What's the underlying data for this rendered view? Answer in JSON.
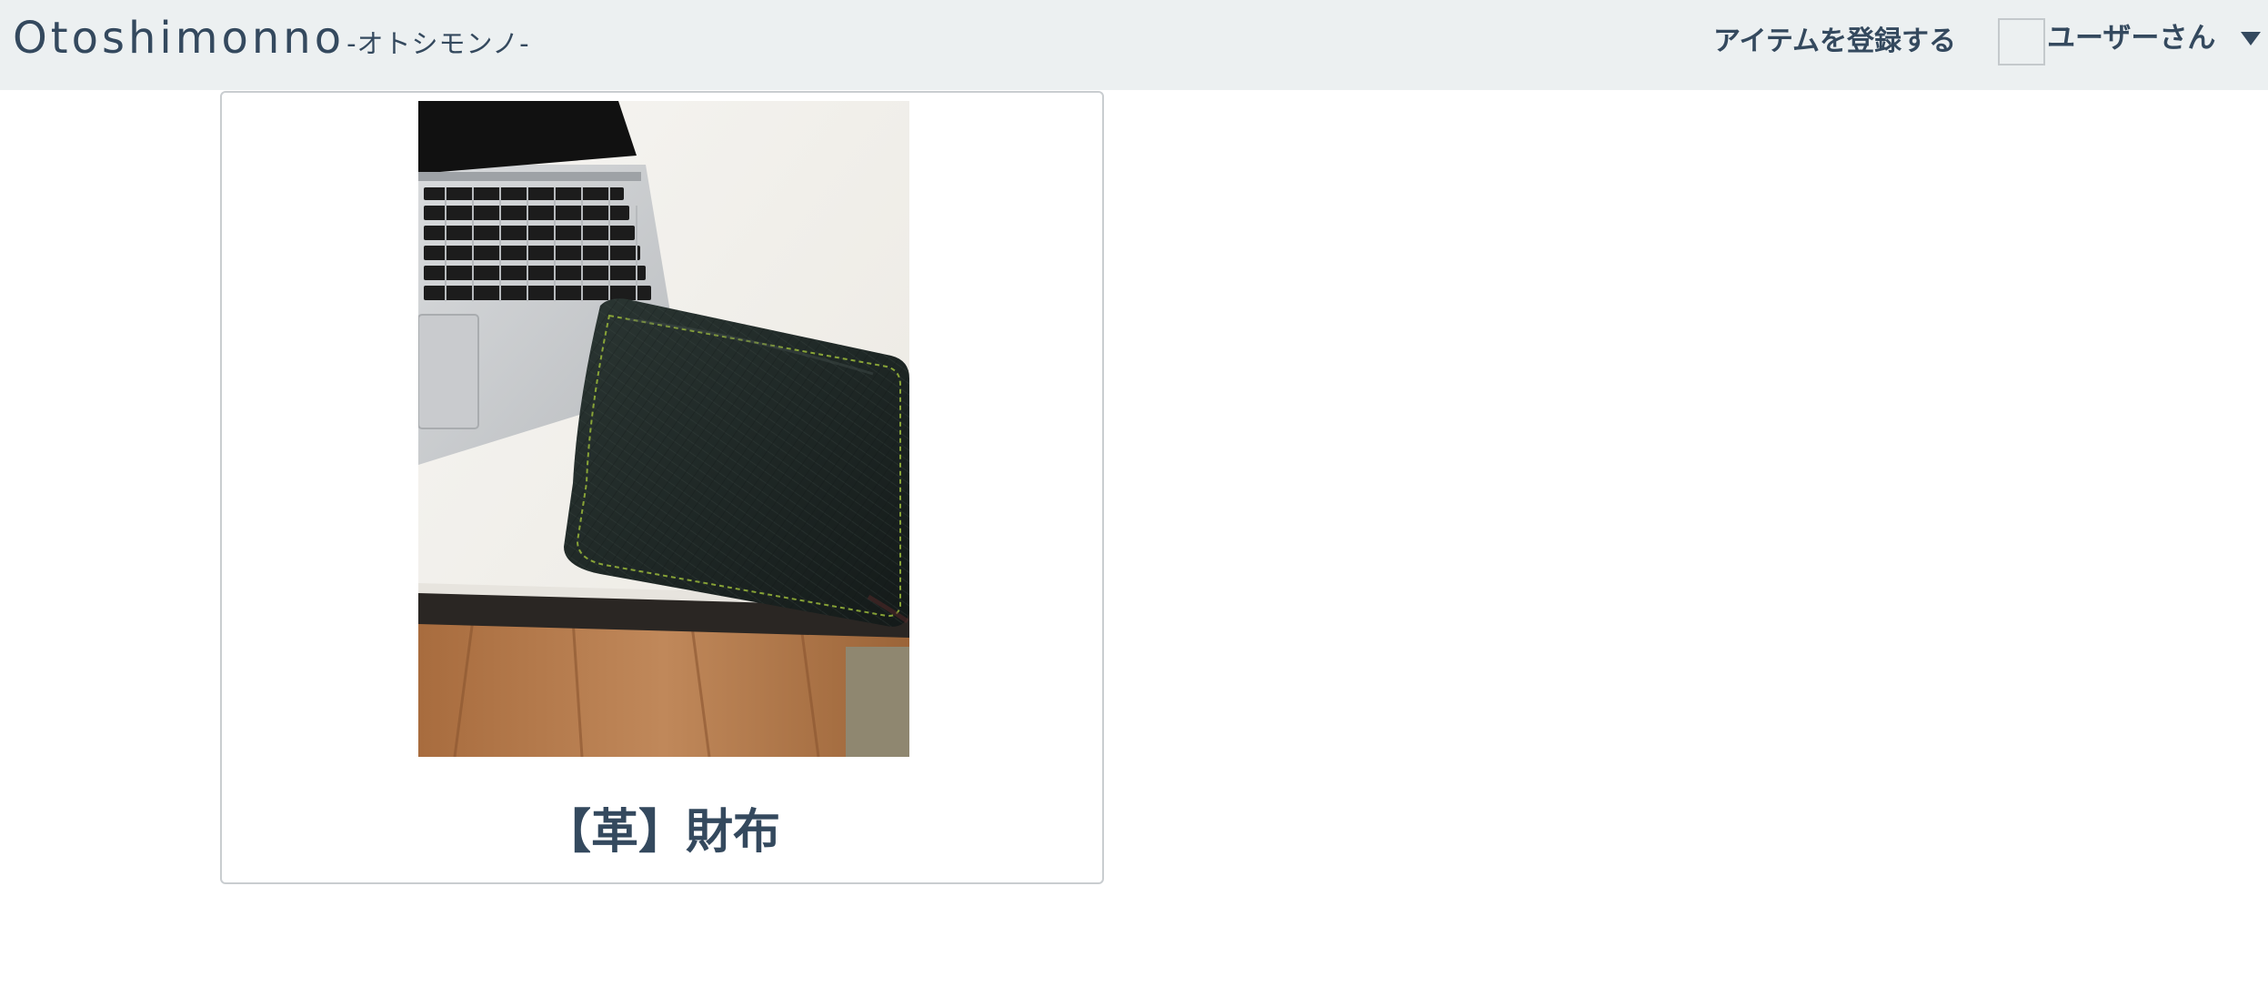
{
  "header": {
    "logo_main": "Otoshimonno",
    "logo_sub": "-オトシモンノ-",
    "register_link": "アイテムを登録する",
    "user_name": "ユーザーさん"
  },
  "items": [
    {
      "title": "【革】財布",
      "image_icon": "wallet-photo"
    }
  ],
  "colors": {
    "header_bg": "#ecf0f1",
    "text": "#34495e",
    "card_border": "#c9cdd0"
  }
}
